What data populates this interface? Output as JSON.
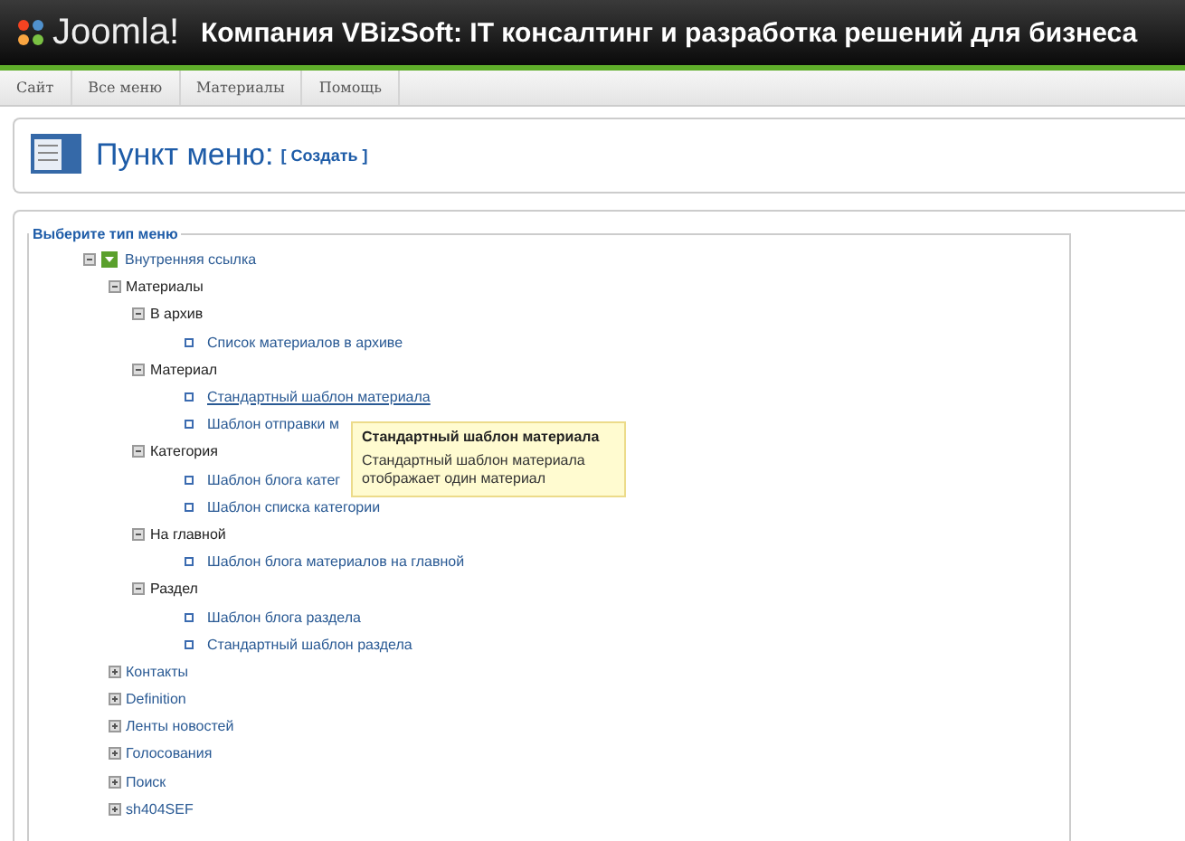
{
  "header": {
    "logo": "Joomla!",
    "title": "Компания VBizSoft: IT консалтинг и разработка решений для бизнеса"
  },
  "menu": [
    "Сайт",
    "Все меню",
    "Материалы",
    "Помощь"
  ],
  "toolbar": {
    "title": "Пункт меню:",
    "action": "[ Создать ]"
  },
  "panel": {
    "legend": "Выберите тип меню"
  },
  "tree": [
    {
      "label": "Внутренняя ссылка",
      "kind": "root",
      "expanded": true,
      "children": [
        {
          "label": "Материалы",
          "kind": "group",
          "expanded": true,
          "children": [
            {
              "label": "В архив",
              "kind": "group",
              "expanded": true,
              "children": [
                {
                  "label": "Список материалов в архиве",
                  "kind": "link",
                  "hovered": false
                }
              ]
            },
            {
              "label": "Материал",
              "kind": "group",
              "expanded": true,
              "children": [
                {
                  "label": "Стандартный шаблон материала",
                  "kind": "link",
                  "hovered": true
                },
                {
                  "label": "Шаблон отправки м",
                  "kind": "link",
                  "hovered": false
                }
              ]
            },
            {
              "label": "Категория",
              "kind": "group",
              "expanded": true,
              "children": [
                {
                  "label": "Шаблон блога катег",
                  "kind": "link",
                  "hovered": false
                },
                {
                  "label": "Шаблон списка категории",
                  "kind": "link",
                  "hovered": false
                }
              ]
            },
            {
              "label": "На главной",
              "kind": "group",
              "expanded": true,
              "children": [
                {
                  "label": "Шаблон блога материалов на главной",
                  "kind": "link",
                  "hovered": false
                }
              ]
            },
            {
              "label": "Раздел",
              "kind": "group",
              "expanded": true,
              "children": [
                {
                  "label": "Шаблон блога раздела",
                  "kind": "link",
                  "hovered": false
                },
                {
                  "label": "Стандартный шаблон раздела",
                  "kind": "link",
                  "hovered": false
                }
              ]
            }
          ]
        },
        {
          "label": "Контакты",
          "kind": "type",
          "expanded": false
        },
        {
          "label": "Definition",
          "kind": "type",
          "expanded": false
        },
        {
          "label": "Ленты новостей",
          "kind": "type",
          "expanded": false
        },
        {
          "label": "Голосования",
          "kind": "type",
          "expanded": false
        },
        {
          "label": "Поиск",
          "kind": "type",
          "expanded": false
        },
        {
          "label": "sh404SEF",
          "kind": "type",
          "expanded": false
        }
      ]
    }
  ],
  "tooltip": {
    "title": "Стандартный шаблон материала",
    "text": "Стандартный шаблон материала отображает один материал"
  }
}
